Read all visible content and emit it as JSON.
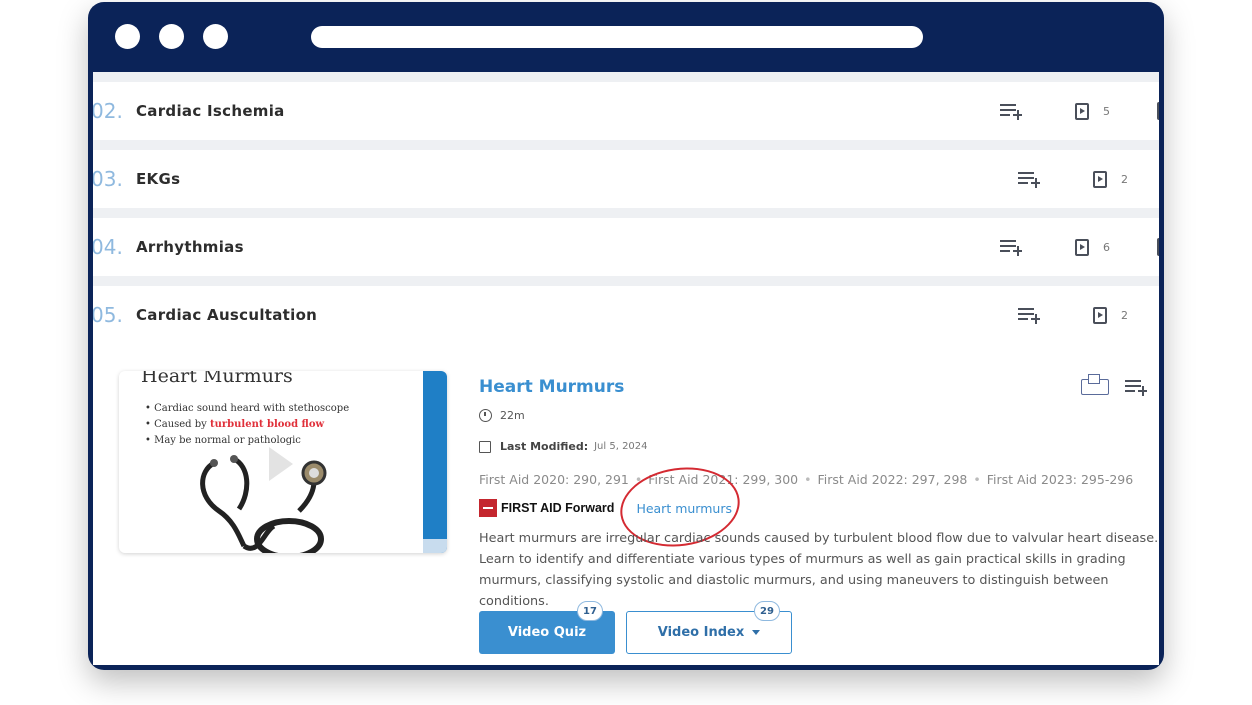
{
  "sections": [
    {
      "number": "02.",
      "title": "Cardiac Ischemia",
      "video_count": "5"
    },
    {
      "number": "03.",
      "title": "EKGs",
      "video_count": "2"
    },
    {
      "number": "04.",
      "title": "Arrhythmias",
      "video_count": "6"
    },
    {
      "number": "05.",
      "title": "Cardiac Auscultation",
      "video_count": "2"
    }
  ],
  "lesson": {
    "title": "Heart Murmurs",
    "duration": "22m",
    "last_modified_label": "Last Modified:",
    "last_modified_value": "Jul 5, 2024",
    "references": [
      "First Aid 2020: 290, 291",
      "First Aid 2021: 299, 300",
      "First Aid 2022: 297, 298",
      "First Aid 2023: 295-296"
    ],
    "first_aid_brand": "FIRST AID Forward",
    "first_aid_link": "Heart murmurs",
    "description": "Heart murmurs are irregular cardiac sounds caused by turbulent blood flow due to valvular heart disease. Learn to identify and differentiate various types of murmurs as well as gain practical skills in grading murmurs, classifying systolic and diastolic murmurs, and using maneuvers to distinguish between conditions.",
    "thumbnail": {
      "title": "Heart Murmurs",
      "bullet_1": "Cardiac sound heard with stethoscope",
      "bullet_2_prefix": "Caused by ",
      "bullet_2_highlight": "turbulent blood flow",
      "bullet_3": "May be normal or pathologic"
    }
  },
  "buttons": {
    "video_quiz": "Video Quiz",
    "video_quiz_count": "17",
    "video_index": "Video Index",
    "video_index_count": "29"
  },
  "icons": {
    "add_to_list": "playlist-add-icon",
    "video": "video-file-icon",
    "flashcards": "flashcards-icon",
    "clock": "clock-icon",
    "calendar": "calendar-icon"
  },
  "colors": {
    "window_frame": "#0b2358",
    "accent_blue": "#3a8fd0",
    "section_number": "#8fb9df",
    "annotation_red": "#d42a32"
  }
}
